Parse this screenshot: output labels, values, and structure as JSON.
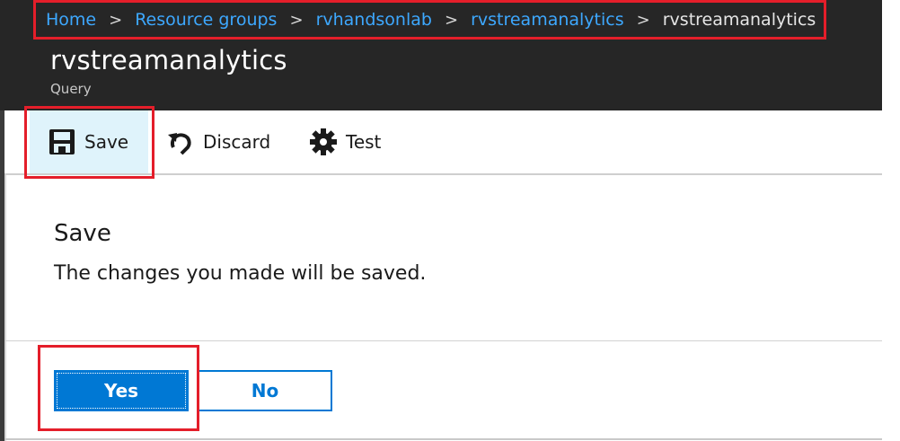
{
  "breadcrumb": {
    "items": [
      {
        "label": "Home"
      },
      {
        "label": "Resource groups"
      },
      {
        "label": "rvhandsonlab"
      },
      {
        "label": "rvstreamanalytics"
      },
      {
        "label": "rvstreamanalytics"
      }
    ]
  },
  "header": {
    "title": "rvstreamanalytics",
    "subtitle": "Query"
  },
  "toolbar": {
    "save_label": "Save",
    "discard_label": "Discard",
    "test_label": "Test",
    "icons": {
      "save": "floppy-disk-icon",
      "discard": "undo-icon",
      "test": "gear-icon"
    }
  },
  "dialog": {
    "title": "Save",
    "message": "The changes you made will be saved.",
    "yes_label": "Yes",
    "no_label": "No"
  },
  "colors": {
    "accent": "#0078d4",
    "link": "#3da8ff",
    "highlight": "#e41e2a",
    "header_bg": "#262626"
  }
}
